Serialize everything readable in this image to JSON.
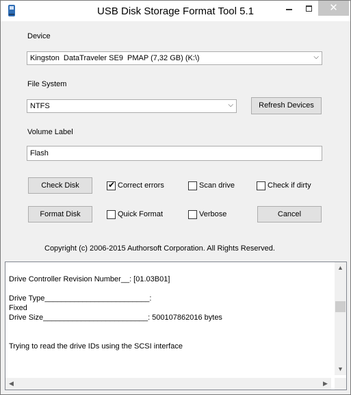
{
  "window": {
    "title": "USB Disk Storage Format Tool 5.1",
    "icon": "usb-drive-icon",
    "controls": {
      "minimize": "minimize-icon",
      "maximize": "maximize-icon",
      "close_glyph": "✕"
    }
  },
  "device": {
    "label": "Device",
    "selected": "Kingston  DataTraveler SE9  PMAP (7,32 GB) (K:\\)"
  },
  "file_system": {
    "label": "File System",
    "selected": "NTFS",
    "refresh_label": "Refresh Devices"
  },
  "volume": {
    "label": "Volume Label",
    "value": "Flash"
  },
  "actions": {
    "check_disk": "Check Disk",
    "format_disk": "Format Disk",
    "cancel": "Cancel"
  },
  "options": [
    {
      "label": "Correct errors",
      "checked": true
    },
    {
      "label": "Scan drive",
      "checked": false
    },
    {
      "label": "Check if dirty",
      "checked": false
    },
    {
      "label": "Quick Format",
      "checked": false
    },
    {
      "label": "Verbose",
      "checked": false
    }
  ],
  "copyright": "Copyright (c) 2006-2015 Authorsoft Corporation. All Rights Reserved.",
  "log_lines": [
    "Drive Controller Revision Number__: [01.03B01]",
    "",
    "Drive Type_________________________:",
    "Fixed",
    "Drive Size_________________________: 500107862016 bytes",
    "",
    "",
    "Trying to read the drive IDs using the SCSI interface"
  ],
  "scrollbar": {
    "up": "▲",
    "down": "▼",
    "left": "◀",
    "right": "▶",
    "vertical_position": 0.35
  }
}
